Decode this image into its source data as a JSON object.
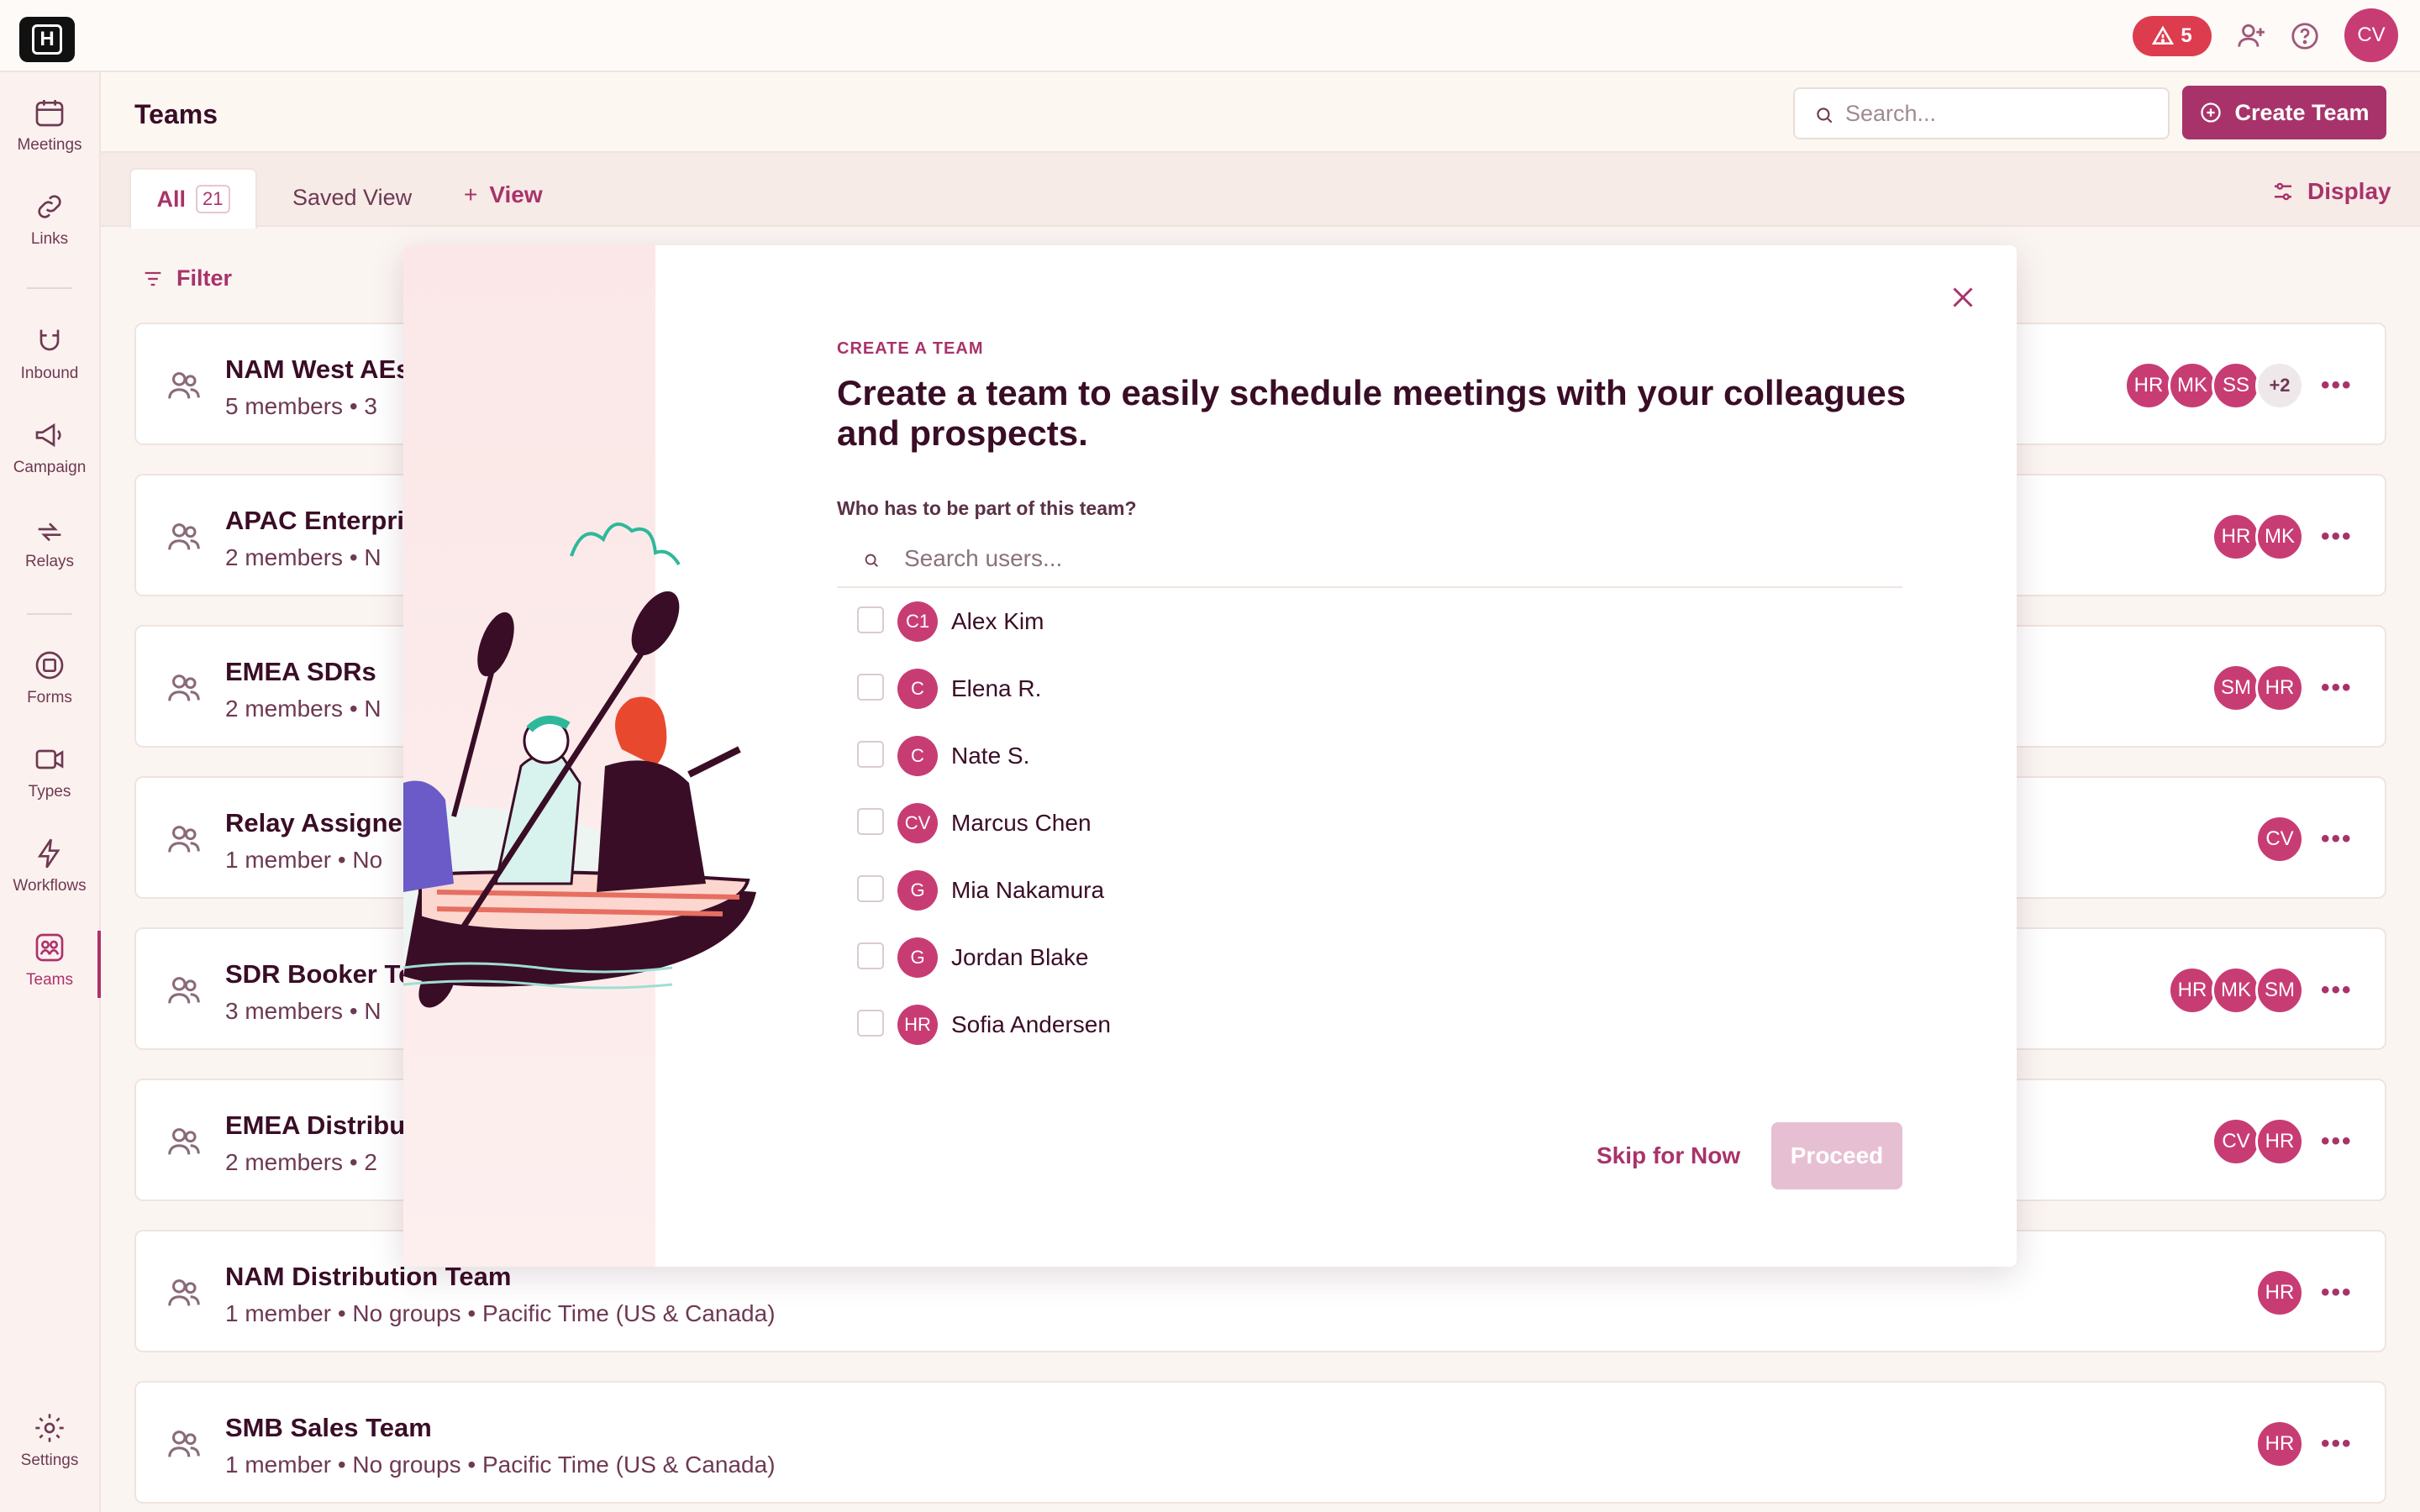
{
  "app": {
    "logo_text": "H",
    "alert_count": "5",
    "user_initials": "CV"
  },
  "sidebar": {
    "items": [
      {
        "label": "Meetings",
        "icon": "calendar-icon"
      },
      {
        "label": "Links",
        "icon": "link-icon"
      },
      {
        "label": "Inbound",
        "icon": "magnet-icon"
      },
      {
        "label": "Campaign",
        "icon": "megaphone-icon"
      },
      {
        "label": "Relays",
        "icon": "relay-icon"
      },
      {
        "label": "Forms",
        "icon": "form-icon"
      },
      {
        "label": "Types",
        "icon": "video-icon"
      },
      {
        "label": "Workflows",
        "icon": "bolt-icon"
      },
      {
        "label": "Teams",
        "icon": "teams-icon"
      },
      {
        "label": "Settings",
        "icon": "gear-icon"
      }
    ]
  },
  "header": {
    "title": "Teams",
    "search_placeholder": "Search...",
    "create_label": "Create Team"
  },
  "tabs": {
    "all_label": "All",
    "all_count": "21",
    "saved_label": "Saved View",
    "view_label": "View",
    "display_label": "Display"
  },
  "filter_label": "Filter",
  "teams": [
    {
      "name": "NAM West AEs",
      "meta": "5 members  •  3",
      "avatars": [
        "HR",
        "MK",
        "SS"
      ],
      "more": "+2"
    },
    {
      "name": "APAC Enterpris",
      "meta": "2 members  •  N",
      "avatars": [
        "HR",
        "MK"
      ],
      "more": ""
    },
    {
      "name": "EMEA SDRs",
      "meta": "2 members  •  N",
      "avatars": [
        "SM",
        "HR"
      ],
      "more": ""
    },
    {
      "name": "Relay Assignee",
      "meta": "1 member  •  No",
      "avatars": [
        "CV"
      ],
      "more": ""
    },
    {
      "name": "SDR Booker Te",
      "meta": "3 members  •  N",
      "avatars": [
        "HR",
        "MK",
        "SM"
      ],
      "more": ""
    },
    {
      "name": "EMEA Distribu",
      "meta": "2 members  •  2",
      "avatars": [
        "CV",
        "HR"
      ],
      "more": ""
    },
    {
      "name": "NAM Distribution Team",
      "meta": "1 member  •  No groups  •  Pacific Time (US & Canada)",
      "avatars": [
        "HR"
      ],
      "more": ""
    },
    {
      "name": "SMB Sales Team",
      "meta": "1 member  •  No groups  •  Pacific Time (US & Canada)",
      "avatars": [
        "HR"
      ],
      "more": ""
    }
  ],
  "modal": {
    "eyebrow": "CREATE A TEAM",
    "title": "Create a team to easily schedule meetings with your colleagues and prospects.",
    "question": "Who has to be part of this team?",
    "search_placeholder": "Search users...",
    "users": [
      {
        "initials": "C1",
        "name": "Alex Kim"
      },
      {
        "initials": "C",
        "name": "Elena R."
      },
      {
        "initials": "C",
        "name": "Nate S."
      },
      {
        "initials": "CV",
        "name": "Marcus Chen"
      },
      {
        "initials": "G",
        "name": "Mia Nakamura"
      },
      {
        "initials": "G",
        "name": "Jordan Blake"
      },
      {
        "initials": "HR",
        "name": "Sofia Andersen"
      }
    ],
    "skip_label": "Skip for Now",
    "proceed_label": "Proceed"
  }
}
